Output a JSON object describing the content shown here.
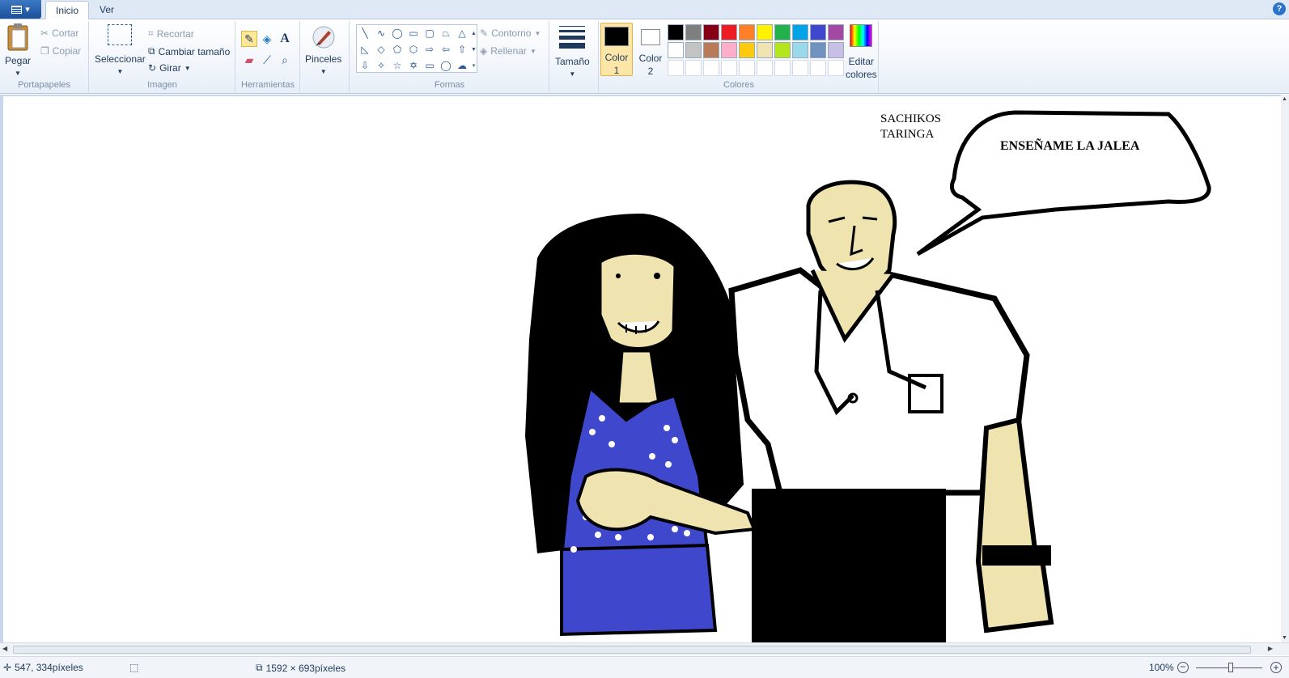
{
  "tabs": {
    "home": "Inicio",
    "view": "Ver"
  },
  "help": "?",
  "clipboard": {
    "paste": "Pegar",
    "cut": "Cortar",
    "copy": "Copiar",
    "label": "Portapapeles"
  },
  "image": {
    "select": "Seleccionar",
    "crop": "Recortar",
    "resize": "Cambiar tamaño",
    "rotate": "Girar",
    "label": "Imagen"
  },
  "tools": {
    "label": "Herramientas",
    "text_tool": "A"
  },
  "brushes": {
    "label": "Pinceles"
  },
  "shapes": {
    "outline": "Contorno",
    "fill": "Rellenar",
    "label": "Formas"
  },
  "size": {
    "label": "Tamaño"
  },
  "colors": {
    "color1_line1": "Color",
    "color1_line2": "1",
    "color2_line1": "Color",
    "color2_line2": "2",
    "edit_line1": "Editar",
    "edit_line2": "colores",
    "label": "Colores",
    "palette_row1": [
      "#000000",
      "#7f7f7f",
      "#880015",
      "#ed1c24",
      "#ff7f27",
      "#fff200",
      "#22b14c",
      "#00a2e8",
      "#3f48cc",
      "#a349a4"
    ],
    "palette_row2": [
      "#ffffff",
      "#c3c3c3",
      "#b97a57",
      "#ffaec9",
      "#ffc90e",
      "#efe4b0",
      "#b5e61d",
      "#99d9ea",
      "#7092be",
      "#c8bfe7"
    ]
  },
  "drawing": {
    "signature_line1": "SACHIKOS",
    "signature_line2": "TARINGA",
    "speech": "ENSEÑAME LA JALEA"
  },
  "status": {
    "cursor_pos": "547, 334píxeles",
    "canvas_size": "1592 × 693píxeles",
    "zoom": "100%"
  },
  "accent": "#1c4f9a"
}
